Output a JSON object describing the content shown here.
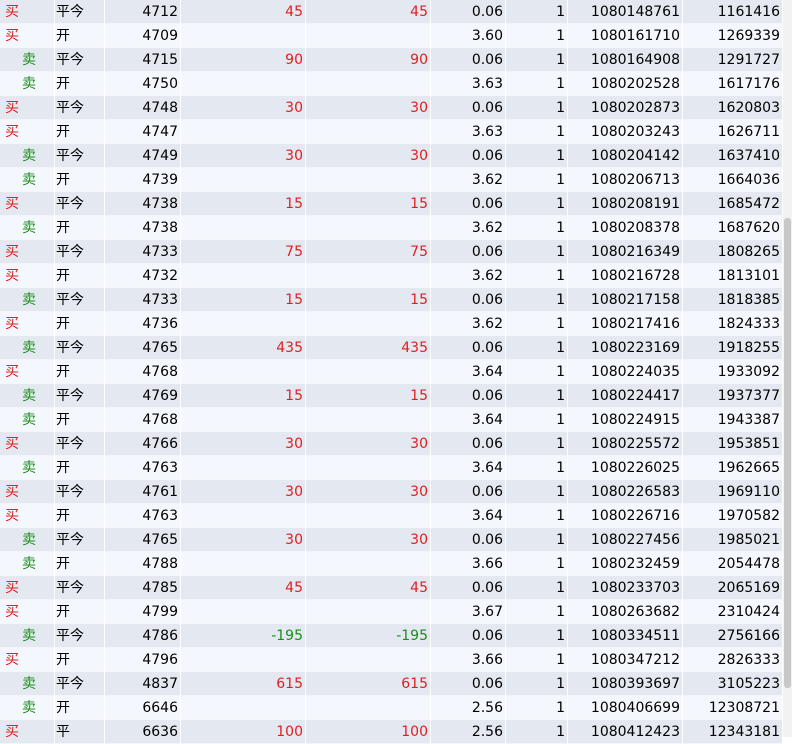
{
  "rows": [
    {
      "side": "买",
      "open": "平今",
      "price": "4712",
      "pl1": "45",
      "pl2": "45",
      "fee": "0.06",
      "qty": "1",
      "order": "1080148761",
      "time": "1161416"
    },
    {
      "side": "买",
      "open": "开",
      "price": "4709",
      "pl1": "",
      "pl2": "",
      "fee": "3.60",
      "qty": "1",
      "order": "1080161710",
      "time": "1269339"
    },
    {
      "side": "卖",
      "open": "平今",
      "price": "4715",
      "pl1": "90",
      "pl2": "90",
      "fee": "0.06",
      "qty": "1",
      "order": "1080164908",
      "time": "1291727"
    },
    {
      "side": "卖",
      "open": "开",
      "price": "4750",
      "pl1": "",
      "pl2": "",
      "fee": "3.63",
      "qty": "1",
      "order": "1080202528",
      "time": "1617176"
    },
    {
      "side": "买",
      "open": "平今",
      "price": "4748",
      "pl1": "30",
      "pl2": "30",
      "fee": "0.06",
      "qty": "1",
      "order": "1080202873",
      "time": "1620803"
    },
    {
      "side": "买",
      "open": "开",
      "price": "4747",
      "pl1": "",
      "pl2": "",
      "fee": "3.63",
      "qty": "1",
      "order": "1080203243",
      "time": "1626711"
    },
    {
      "side": "卖",
      "open": "平今",
      "price": "4749",
      "pl1": "30",
      "pl2": "30",
      "fee": "0.06",
      "qty": "1",
      "order": "1080204142",
      "time": "1637410"
    },
    {
      "side": "卖",
      "open": "开",
      "price": "4739",
      "pl1": "",
      "pl2": "",
      "fee": "3.62",
      "qty": "1",
      "order": "1080206713",
      "time": "1664036"
    },
    {
      "side": "买",
      "open": "平今",
      "price": "4738",
      "pl1": "15",
      "pl2": "15",
      "fee": "0.06",
      "qty": "1",
      "order": "1080208191",
      "time": "1685472"
    },
    {
      "side": "卖",
      "open": "开",
      "price": "4738",
      "pl1": "",
      "pl2": "",
      "fee": "3.62",
      "qty": "1",
      "order": "1080208378",
      "time": "1687620"
    },
    {
      "side": "买",
      "open": "平今",
      "price": "4733",
      "pl1": "75",
      "pl2": "75",
      "fee": "0.06",
      "qty": "1",
      "order": "1080216349",
      "time": "1808265"
    },
    {
      "side": "买",
      "open": "开",
      "price": "4732",
      "pl1": "",
      "pl2": "",
      "fee": "3.62",
      "qty": "1",
      "order": "1080216728",
      "time": "1813101"
    },
    {
      "side": "卖",
      "open": "平今",
      "price": "4733",
      "pl1": "15",
      "pl2": "15",
      "fee": "0.06",
      "qty": "1",
      "order": "1080217158",
      "time": "1818385"
    },
    {
      "side": "买",
      "open": "开",
      "price": "4736",
      "pl1": "",
      "pl2": "",
      "fee": "3.62",
      "qty": "1",
      "order": "1080217416",
      "time": "1824333"
    },
    {
      "side": "卖",
      "open": "平今",
      "price": "4765",
      "pl1": "435",
      "pl2": "435",
      "fee": "0.06",
      "qty": "1",
      "order": "1080223169",
      "time": "1918255"
    },
    {
      "side": "买",
      "open": "开",
      "price": "4768",
      "pl1": "",
      "pl2": "",
      "fee": "3.64",
      "qty": "1",
      "order": "1080224035",
      "time": "1933092"
    },
    {
      "side": "卖",
      "open": "平今",
      "price": "4769",
      "pl1": "15",
      "pl2": "15",
      "fee": "0.06",
      "qty": "1",
      "order": "1080224417",
      "time": "1937377"
    },
    {
      "side": "卖",
      "open": "开",
      "price": "4768",
      "pl1": "",
      "pl2": "",
      "fee": "3.64",
      "qty": "1",
      "order": "1080224915",
      "time": "1943387"
    },
    {
      "side": "买",
      "open": "平今",
      "price": "4766",
      "pl1": "30",
      "pl2": "30",
      "fee": "0.06",
      "qty": "1",
      "order": "1080225572",
      "time": "1953851"
    },
    {
      "side": "卖",
      "open": "开",
      "price": "4763",
      "pl1": "",
      "pl2": "",
      "fee": "3.64",
      "qty": "1",
      "order": "1080226025",
      "time": "1962665"
    },
    {
      "side": "买",
      "open": "平今",
      "price": "4761",
      "pl1": "30",
      "pl2": "30",
      "fee": "0.06",
      "qty": "1",
      "order": "1080226583",
      "time": "1969110"
    },
    {
      "side": "买",
      "open": "开",
      "price": "4763",
      "pl1": "",
      "pl2": "",
      "fee": "3.64",
      "qty": "1",
      "order": "1080226716",
      "time": "1970582"
    },
    {
      "side": "卖",
      "open": "平今",
      "price": "4765",
      "pl1": "30",
      "pl2": "30",
      "fee": "0.06",
      "qty": "1",
      "order": "1080227456",
      "time": "1985021"
    },
    {
      "side": "卖",
      "open": "开",
      "price": "4788",
      "pl1": "",
      "pl2": "",
      "fee": "3.66",
      "qty": "1",
      "order": "1080232459",
      "time": "2054478"
    },
    {
      "side": "买",
      "open": "平今",
      "price": "4785",
      "pl1": "45",
      "pl2": "45",
      "fee": "0.06",
      "qty": "1",
      "order": "1080233703",
      "time": "2065169"
    },
    {
      "side": "买",
      "open": "开",
      "price": "4799",
      "pl1": "",
      "pl2": "",
      "fee": "3.67",
      "qty": "1",
      "order": "1080263682",
      "time": "2310424"
    },
    {
      "side": "卖",
      "open": "平今",
      "price": "4786",
      "pl1": "-195",
      "pl2": "-195",
      "fee": "0.06",
      "qty": "1",
      "order": "1080334511",
      "time": "2756166"
    },
    {
      "side": "买",
      "open": "开",
      "price": "4796",
      "pl1": "",
      "pl2": "",
      "fee": "3.66",
      "qty": "1",
      "order": "1080347212",
      "time": "2826333"
    },
    {
      "side": "卖",
      "open": "平今",
      "price": "4837",
      "pl1": "615",
      "pl2": "615",
      "fee": "0.06",
      "qty": "1",
      "order": "1080393697",
      "time": "3105223"
    },
    {
      "side": "卖",
      "open": "开",
      "price": "6646",
      "pl1": "",
      "pl2": "",
      "fee": "2.56",
      "qty": "1",
      "order": "1080406699",
      "time": "12308721"
    },
    {
      "side": "买",
      "open": "平",
      "price": "6636",
      "pl1": "100",
      "pl2": "100",
      "fee": "2.56",
      "qty": "1",
      "order": "1080412423",
      "time": "12343181"
    }
  ]
}
